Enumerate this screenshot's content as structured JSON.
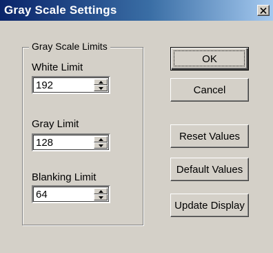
{
  "window": {
    "title": "Gray Scale Settings",
    "close_icon": "close-icon"
  },
  "groupbox": {
    "label": "Gray Scale Limits"
  },
  "fields": [
    {
      "label": "White Limit",
      "value": "192"
    },
    {
      "label": "Gray Limit",
      "value": "128"
    },
    {
      "label": "Blanking Limit",
      "value": "64"
    }
  ],
  "buttons": {
    "ok": "OK",
    "cancel": "Cancel",
    "reset": "Reset Values",
    "default": "Default Values",
    "update": "Update Display"
  }
}
